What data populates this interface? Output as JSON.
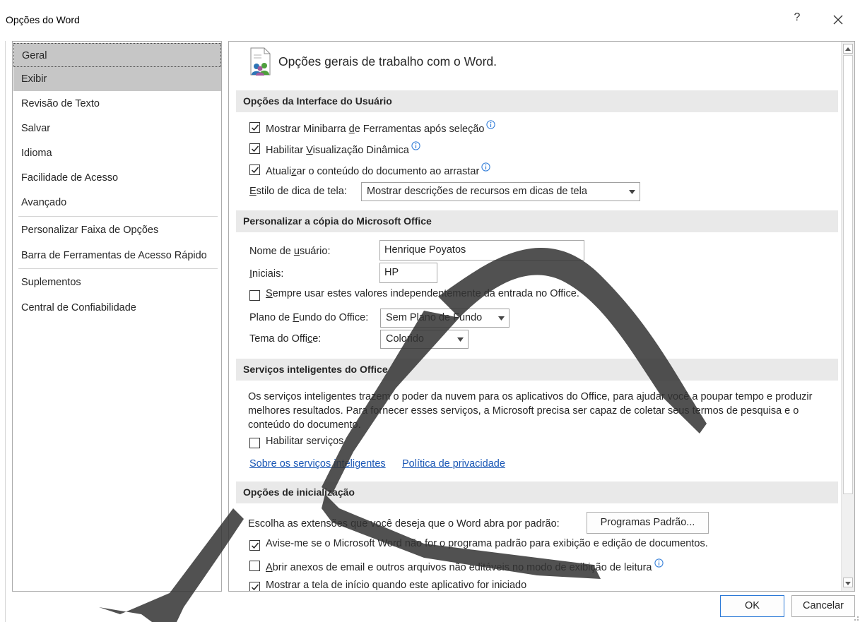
{
  "window": {
    "title": "Opções do Word",
    "help_label": "?"
  },
  "sidebar": {
    "items": [
      {
        "label": "Geral"
      },
      {
        "label": "Exibir"
      },
      {
        "label": "Revisão de Texto"
      },
      {
        "label": "Salvar"
      },
      {
        "label": "Idioma"
      },
      {
        "label": "Facilidade de Acesso"
      },
      {
        "label": "Avançado"
      },
      {
        "label": "Personalizar Faixa de Opções"
      },
      {
        "label": "Barra de Ferramentas de Acesso Rápido"
      },
      {
        "label": "Suplementos"
      },
      {
        "label": "Central de Confiabilidade"
      }
    ],
    "selected": "Geral"
  },
  "main": {
    "header_title": "Opções gerais de trabalho com o Word.",
    "ui_options": {
      "section_title": "Opções da Interface do Usuário",
      "minibar": {
        "pre": "Mostrar Minibarra ",
        "key": "d",
        "post": "e Ferramentas após seleção",
        "checked": true
      },
      "live_preview": {
        "pre": "Habilitar ",
        "key": "V",
        "post": "isualização Dinâmica",
        "checked": true
      },
      "update_drag": {
        "pre": "Atuali",
        "key": "z",
        "post": "ar o conteúdo do documento ao arrastar",
        "checked": true
      },
      "screentip": {
        "label_key": "E",
        "label_rest": "stilo de dica de tela:",
        "value": "Mostrar descrições de recursos em dicas de tela"
      }
    },
    "personalize": {
      "section_title": "Personalizar a cópia do Microsoft Office",
      "username": {
        "label_pre": "Nome de ",
        "label_key": "u",
        "label_post": "suário:",
        "value": "Henrique Poyatos"
      },
      "initials": {
        "label_key": "I",
        "label_rest": "niciais:",
        "value": "HP"
      },
      "always_use": {
        "key": "S",
        "post": "empre usar estes valores independentemente da entrada no Office.",
        "checked": false
      },
      "background": {
        "label_pre": "Plano de ",
        "label_key": "F",
        "label_post": "undo do Office:",
        "value": "Sem Plano de Fundo"
      },
      "theme": {
        "label_pre": "Tema do Offi",
        "label_key": "c",
        "label_post": "e:",
        "value": "Colorido"
      }
    },
    "intelligent": {
      "section_title": "Serviços inteligentes do Office",
      "description": "Os serviços inteligentes trazem o poder da nuvem para os aplicativos do Office, para ajudar você a poupar tempo e produzir melhores resultados. Para fornecer esses serviços, a Microsoft precisa ser capaz de coletar seus termos de pesquisa e o conteúdo do documento.",
      "enable": {
        "label": "Habilitar serviços",
        "checked": false
      },
      "link_about": "Sobre os serviços inteligentes",
      "link_privacy": "Política de privacidade"
    },
    "startup": {
      "section_title": "Opções de inicialização",
      "extensions_label": "Escolha as extensões que você deseja que o Word abra por padrão:",
      "default_programs_button": "Programas Padrão...",
      "warn_default": {
        "label": "Avise-me se o Microsoft Word não for o programa padrão para exibição e edição de documentos.",
        "checked": true
      },
      "open_attachments": {
        "key": "A",
        "post": "brir anexos de email e outros arquivos não editáveis no modo de exibição de leitura",
        "checked": false
      },
      "show_start": {
        "label": "Mostrar a tela de início quando este aplicativo for iniciado",
        "checked": true
      }
    }
  },
  "footer": {
    "ok": "OK",
    "cancel": "Cancelar"
  },
  "colors": {
    "accent": "#2b79d7",
    "link": "#1b58b6",
    "section_bg": "#e9e9e9",
    "selected_bg": "#c6c6c6"
  }
}
